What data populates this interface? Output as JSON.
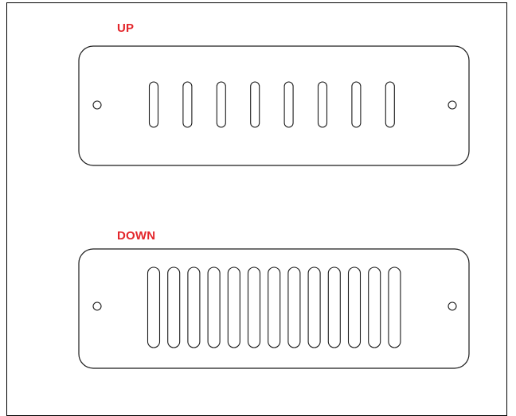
{
  "labels": {
    "up": "UP",
    "down": "DOWN"
  },
  "colors": {
    "label": "#e3262b",
    "stroke": "#1a1a1a",
    "background": "#ffffff"
  },
  "plates": [
    {
      "name": "up-plate",
      "slot_count": 8
    },
    {
      "name": "down-plate",
      "slot_count": 13
    }
  ]
}
